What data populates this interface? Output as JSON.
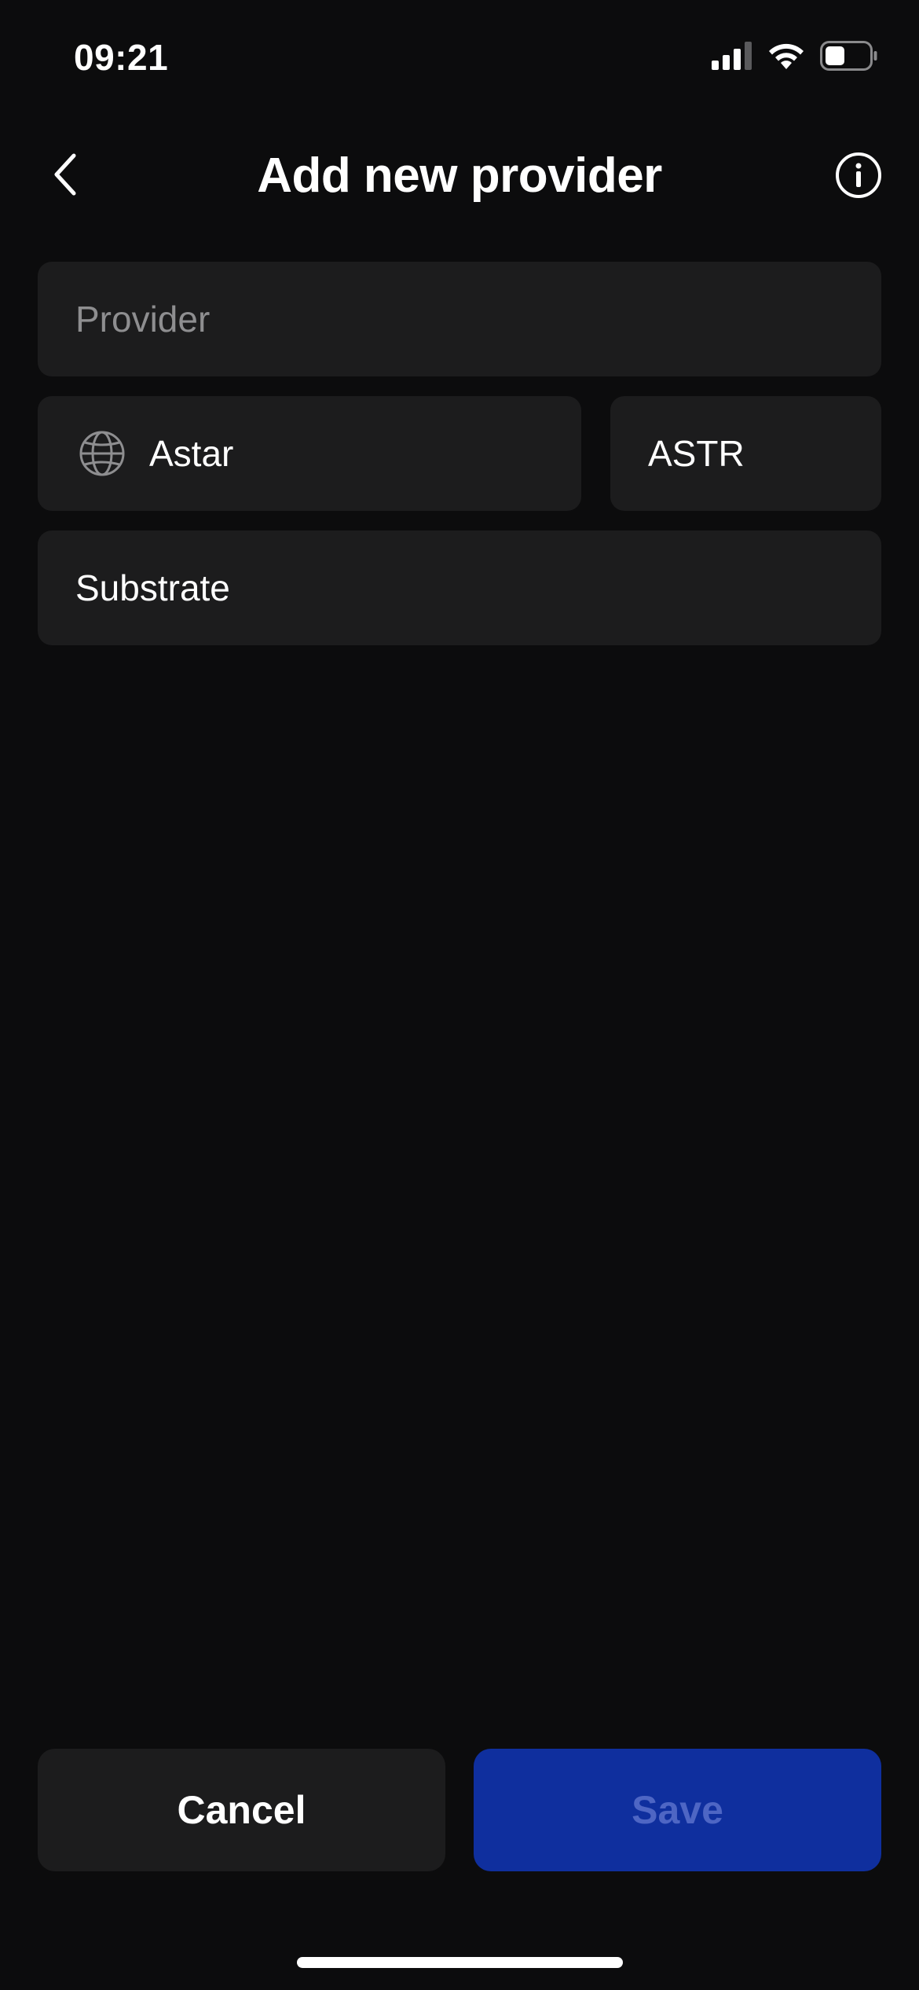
{
  "status_bar": {
    "time": "09:21",
    "icons": [
      "cellular-signal-icon",
      "wifi-icon",
      "battery-icon"
    ]
  },
  "header": {
    "title": "Add new provider",
    "back_icon": "chevron-left-icon",
    "info_icon": "info-icon"
  },
  "form": {
    "provider": {
      "value": "",
      "placeholder": "Provider"
    },
    "network": {
      "icon": "globe-icon",
      "value": "Astar"
    },
    "symbol": {
      "value": "ASTR"
    },
    "type": {
      "value": "Substrate"
    }
  },
  "actions": {
    "cancel_label": "Cancel",
    "save_label": "Save"
  },
  "colors": {
    "background": "#0c0c0d",
    "field_background": "#1c1c1d",
    "placeholder": "#8e8e90",
    "save_button_background": "#0f2f9e",
    "save_button_text": "#4e66c4"
  }
}
